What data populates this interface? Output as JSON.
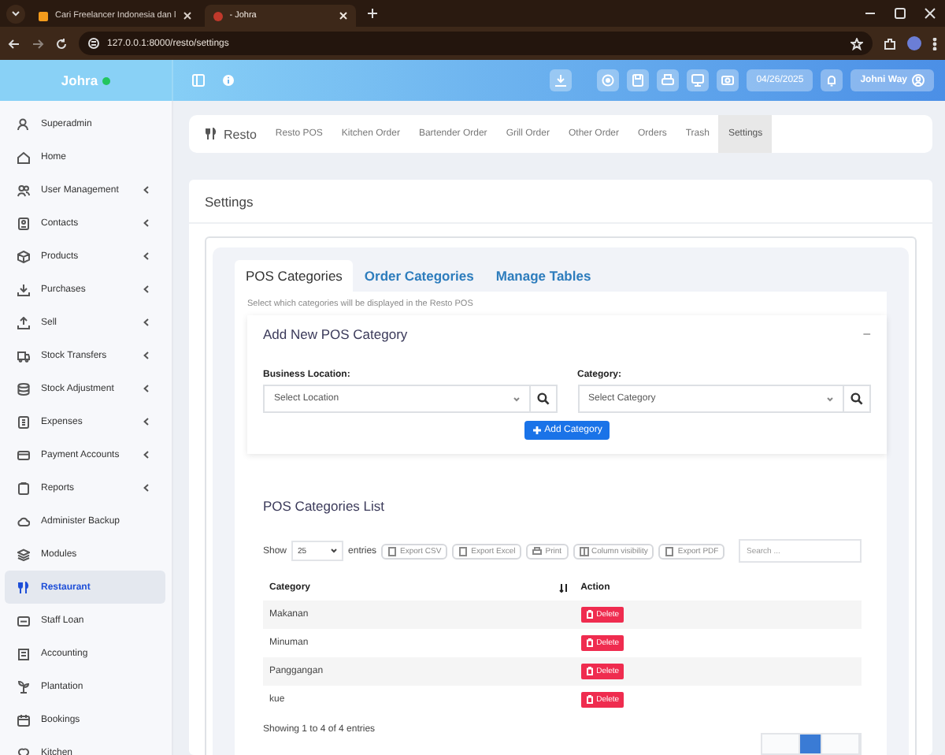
{
  "browser": {
    "tabs": [
      {
        "title": "Cari Freelancer Indonesia dan l",
        "selected": false
      },
      {
        "title": "- Johra",
        "selected": true
      }
    ],
    "url": "127.0.0.1:8000/resto/settings"
  },
  "header": {
    "brand": "Johra",
    "online": true,
    "date": "04/26/2025",
    "user": "Johni Way"
  },
  "sidebar": {
    "items": [
      {
        "label": "Superadmin",
        "expandable": false,
        "selected": false
      },
      {
        "label": "Home",
        "expandable": false,
        "selected": false
      },
      {
        "label": "User Management",
        "expandable": true,
        "selected": false
      },
      {
        "label": "Contacts",
        "expandable": true,
        "selected": false
      },
      {
        "label": "Products",
        "expandable": true,
        "selected": false
      },
      {
        "label": "Purchases",
        "expandable": true,
        "selected": false
      },
      {
        "label": "Sell",
        "expandable": true,
        "selected": false
      },
      {
        "label": "Stock Transfers",
        "expandable": true,
        "selected": false
      },
      {
        "label": "Stock Adjustment",
        "expandable": true,
        "selected": false
      },
      {
        "label": "Expenses",
        "expandable": true,
        "selected": false
      },
      {
        "label": "Payment Accounts",
        "expandable": true,
        "selected": false
      },
      {
        "label": "Reports",
        "expandable": true,
        "selected": false
      },
      {
        "label": "Administer Backup",
        "expandable": false,
        "selected": false
      },
      {
        "label": "Modules",
        "expandable": false,
        "selected": false
      },
      {
        "label": "Restaurant",
        "expandable": false,
        "selected": true
      },
      {
        "label": "Staff Loan",
        "expandable": false,
        "selected": false
      },
      {
        "label": "Accounting",
        "expandable": false,
        "selected": false
      },
      {
        "label": "Plantation",
        "expandable": false,
        "selected": false
      },
      {
        "label": "Bookings",
        "expandable": false,
        "selected": false
      },
      {
        "label": "Kitchen",
        "expandable": false,
        "selected": false
      }
    ]
  },
  "resto_nav": {
    "brand": "Resto",
    "items": [
      {
        "label": "Resto POS",
        "selected": false
      },
      {
        "label": "Kitchen Order",
        "selected": false
      },
      {
        "label": "Bartender Order",
        "selected": false
      },
      {
        "label": "Grill Order",
        "selected": false
      },
      {
        "label": "Other Order",
        "selected": false
      },
      {
        "label": "Orders",
        "selected": false
      },
      {
        "label": "Trash",
        "selected": false
      },
      {
        "label": "Settings",
        "selected": true
      }
    ]
  },
  "page_title": "Settings",
  "settings_tabs": [
    {
      "label": "POS Categories",
      "selected": true
    },
    {
      "label": "Order Categories",
      "selected": false
    },
    {
      "label": "Manage Tables",
      "selected": false
    }
  ],
  "hint": "Select which categories will be displayed in the Resto POS",
  "add_form": {
    "title": "Add New POS Category",
    "collapse": "−",
    "fields": [
      {
        "label": "Business Location:",
        "placeholder": "Select Location"
      },
      {
        "label": "Category:",
        "placeholder": "Select Category"
      }
    ],
    "button": "Add Category"
  },
  "list": {
    "title": "POS Categories List",
    "show_label": "Show",
    "page_size": "25",
    "entries_label": "entries",
    "export_buttons": [
      "Export CSV",
      "Export Excel",
      "Print",
      "Column visibility",
      "Export PDF"
    ],
    "search_placeholder": "Search ...",
    "columns": [
      "Category",
      "Action"
    ],
    "rows": [
      {
        "category": "Makanan",
        "action": "Delete"
      },
      {
        "category": "Minuman",
        "action": "Delete"
      },
      {
        "category": "Panggangan",
        "action": "Delete"
      },
      {
        "category": "kue",
        "action": "Delete"
      }
    ],
    "info": "Showing 1 to 4 of 4 entries",
    "pagination": [
      {
        "selected": false
      },
      {
        "selected": true
      },
      {
        "selected": false
      }
    ]
  }
}
